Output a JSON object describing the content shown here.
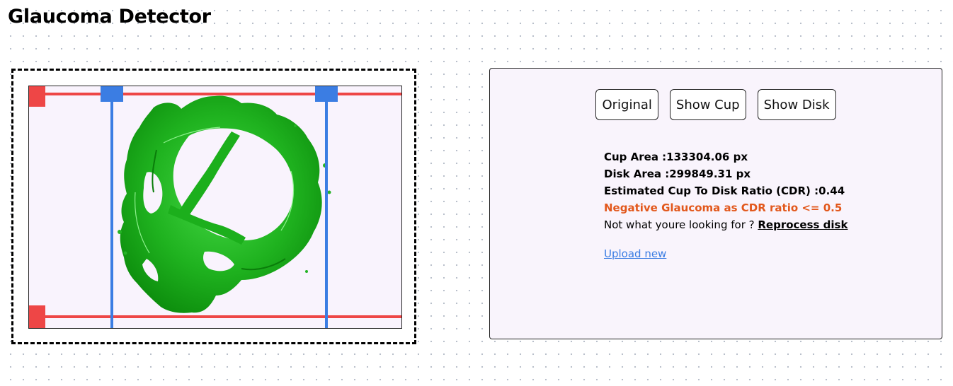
{
  "app": {
    "title": "Glaucoma Detector"
  },
  "colors": {
    "crop_line": "#ee4646",
    "guide_line": "#3b7de3",
    "cup_region": "#22b622",
    "negative_result": "#e2581c",
    "link": "#3b7de3"
  },
  "viewer": {
    "image": "segmented-optic-disk",
    "cropper": "resize-handles"
  },
  "controls": {
    "original_label": "Original",
    "show_cup_label": "Show Cup",
    "show_disk_label": "Show Disk"
  },
  "results": {
    "cup_area": "Cup Area :133304.06 px",
    "disk_area": "Disk Area :299849.31 px",
    "cdr": "Estimated Cup To Disk Ratio (CDR) :0.44",
    "verdict": "Negative Glaucoma as CDR ratio <= 0.5",
    "prompt": "Not what youre looking for ? ",
    "reprocess_label": "Reprocess disk",
    "upload_label": "Upload new"
  }
}
